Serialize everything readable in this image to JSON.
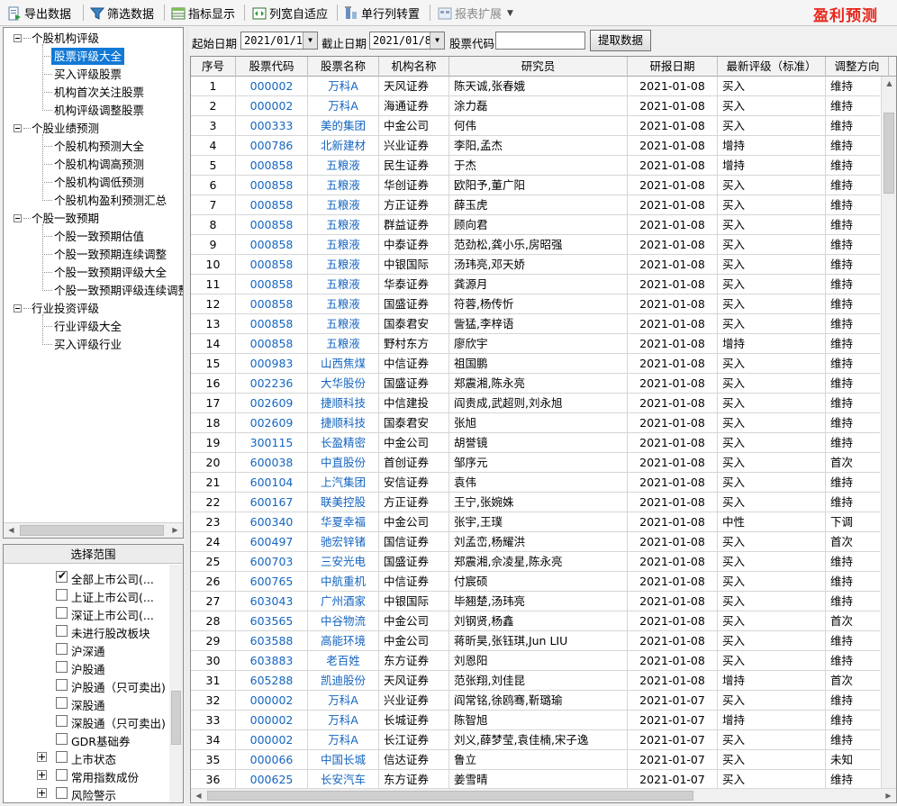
{
  "toolbar": {
    "export_label": "导出数据",
    "filter_label": "筛选数据",
    "indicator_label": "指标显示",
    "autofit_label": "列宽自适应",
    "transpose_label": "单行列转置",
    "extend_label": "报表扩展",
    "brand": "盈利预测"
  },
  "tree": {
    "groups": [
      {
        "label": "个股机构评级",
        "items": [
          "股票评级大全",
          "买入评级股票",
          "机构首次关注股票",
          "机构评级调整股票"
        ]
      },
      {
        "label": "个股业绩预测",
        "items": [
          "个股机构预测大全",
          "个股机构调高预测",
          "个股机构调低预测",
          "个股机构盈利预测汇总"
        ]
      },
      {
        "label": "个股一致预期",
        "items": [
          "个股一致预期估值",
          "个股一致预期连续调整",
          "个股一致预期评级大全",
          "个股一致预期评级连续调整"
        ]
      },
      {
        "label": "行业投资评级",
        "items": [
          "行业评级大全",
          "买入评级行业"
        ]
      }
    ],
    "selected": "股票评级大全"
  },
  "range": {
    "header": "选择范围",
    "items": [
      {
        "label": "全部上市公司(...",
        "checked": true
      },
      {
        "label": "上证上市公司(...",
        "checked": false
      },
      {
        "label": "深证上市公司(...",
        "checked": false
      },
      {
        "label": "未进行股改板块",
        "checked": false
      },
      {
        "label": "沪深通",
        "checked": false
      },
      {
        "label": "沪股通",
        "checked": false
      },
      {
        "label": "沪股通（只可卖出)",
        "checked": false
      },
      {
        "label": "深股通",
        "checked": false
      },
      {
        "label": "深股通（只可卖出)",
        "checked": false
      },
      {
        "label": "GDR基础券",
        "checked": false
      }
    ],
    "expandable": [
      "上市状态",
      "常用指数成份",
      "风险警示"
    ]
  },
  "filter": {
    "start_label": "起始日期",
    "start_value": "2021/01/1",
    "end_label": "截止日期",
    "end_value": "2021/01/8",
    "code_label": "股票代码",
    "code_value": "",
    "fetch_label": "提取数据"
  },
  "grid": {
    "columns": [
      "序号",
      "股票代码",
      "股票名称",
      "机构名称",
      "研究员",
      "研报日期",
      "最新评级（标准）",
      "调整方向"
    ],
    "rows": [
      [
        "1",
        "000002",
        "万科A",
        "天风证券",
        "陈天诚,张春娥",
        "2021-01-08",
        "买入",
        "维持"
      ],
      [
        "2",
        "000002",
        "万科A",
        "海通证券",
        "涂力磊",
        "2021-01-08",
        "买入",
        "维持"
      ],
      [
        "3",
        "000333",
        "美的集团",
        "中金公司",
        "何伟",
        "2021-01-08",
        "买入",
        "维持"
      ],
      [
        "4",
        "000786",
        "北新建材",
        "兴业证券",
        "李阳,孟杰",
        "2021-01-08",
        "增持",
        "维持"
      ],
      [
        "5",
        "000858",
        "五粮液",
        "民生证券",
        "于杰",
        "2021-01-08",
        "增持",
        "维持"
      ],
      [
        "6",
        "000858",
        "五粮液",
        "华创证券",
        "欧阳予,董广阳",
        "2021-01-08",
        "买入",
        "维持"
      ],
      [
        "7",
        "000858",
        "五粮液",
        "方正证券",
        "薛玉虎",
        "2021-01-08",
        "买入",
        "维持"
      ],
      [
        "8",
        "000858",
        "五粮液",
        "群益证券",
        "顾向君",
        "2021-01-08",
        "买入",
        "维持"
      ],
      [
        "9",
        "000858",
        "五粮液",
        "中泰证券",
        "范劲松,龚小乐,房昭强",
        "2021-01-08",
        "买入",
        "维持"
      ],
      [
        "10",
        "000858",
        "五粮液",
        "中银国际",
        "汤玮亮,邓天娇",
        "2021-01-08",
        "买入",
        "维持"
      ],
      [
        "11",
        "000858",
        "五粮液",
        "华泰证券",
        "龚源月",
        "2021-01-08",
        "买入",
        "维持"
      ],
      [
        "12",
        "000858",
        "五粮液",
        "国盛证券",
        "符蓉,杨传忻",
        "2021-01-08",
        "买入",
        "维持"
      ],
      [
        "13",
        "000858",
        "五粮液",
        "国泰君安",
        "訾猛,李梓语",
        "2021-01-08",
        "买入",
        "维持"
      ],
      [
        "14",
        "000858",
        "五粮液",
        "野村东方",
        "廖欣宇",
        "2021-01-08",
        "增持",
        "维持"
      ],
      [
        "15",
        "000983",
        "山西焦煤",
        "中信证券",
        "祖国鹏",
        "2021-01-08",
        "买入",
        "维持"
      ],
      [
        "16",
        "002236",
        "大华股份",
        "国盛证券",
        "郑震湘,陈永亮",
        "2021-01-08",
        "买入",
        "维持"
      ],
      [
        "17",
        "002609",
        "捷顺科技",
        "中信建投",
        "阎贵成,武超则,刘永旭",
        "2021-01-08",
        "买入",
        "维持"
      ],
      [
        "18",
        "002609",
        "捷顺科技",
        "国泰君安",
        "张旭",
        "2021-01-08",
        "买入",
        "维持"
      ],
      [
        "19",
        "300115",
        "长盈精密",
        "中金公司",
        "胡誉镜",
        "2021-01-08",
        "买入",
        "维持"
      ],
      [
        "20",
        "600038",
        "中直股份",
        "首创证券",
        "邹序元",
        "2021-01-08",
        "买入",
        "首次"
      ],
      [
        "21",
        "600104",
        "上汽集团",
        "安信证券",
        "袁伟",
        "2021-01-08",
        "买入",
        "维持"
      ],
      [
        "22",
        "600167",
        "联美控股",
        "方正证券",
        "王宁,张婉姝",
        "2021-01-08",
        "买入",
        "维持"
      ],
      [
        "23",
        "600340",
        "华夏幸福",
        "中金公司",
        "张宇,王璞",
        "2021-01-08",
        "中性",
        "下调"
      ],
      [
        "24",
        "600497",
        "驰宏锌锗",
        "国信证券",
        "刘孟峦,杨耀洪",
        "2021-01-08",
        "买入",
        "首次"
      ],
      [
        "25",
        "600703",
        "三安光电",
        "国盛证券",
        "郑震湘,佘凌星,陈永亮",
        "2021-01-08",
        "买入",
        "维持"
      ],
      [
        "26",
        "600765",
        "中航重机",
        "中信证券",
        "付宸硕",
        "2021-01-08",
        "买入",
        "维持"
      ],
      [
        "27",
        "603043",
        "广州酒家",
        "中银国际",
        "毕翘楚,汤玮亮",
        "2021-01-08",
        "买入",
        "维持"
      ],
      [
        "28",
        "603565",
        "中谷物流",
        "中金公司",
        "刘钢贤,杨鑫",
        "2021-01-08",
        "买入",
        "首次"
      ],
      [
        "29",
        "603588",
        "高能环境",
        "中金公司",
        "蒋昕昊,张钰琪,Jun LIU",
        "2021-01-08",
        "买入",
        "维持"
      ],
      [
        "30",
        "603883",
        "老百姓",
        "东方证券",
        "刘恩阳",
        "2021-01-08",
        "买入",
        "维持"
      ],
      [
        "31",
        "605288",
        "凯迪股份",
        "天风证券",
        "范张翔,刘佳昆",
        "2021-01-08",
        "增持",
        "首次"
      ],
      [
        "32",
        "000002",
        "万科A",
        "兴业证券",
        "阎常铭,徐鸥骞,靳璐瑜",
        "2021-01-07",
        "买入",
        "维持"
      ],
      [
        "33",
        "000002",
        "万科A",
        "长城证券",
        "陈智旭",
        "2021-01-07",
        "增持",
        "维持"
      ],
      [
        "34",
        "000002",
        "万科A",
        "长江证券",
        "刘义,薛梦莹,袁佳楠,宋子逸",
        "2021-01-07",
        "买入",
        "维持"
      ],
      [
        "35",
        "000066",
        "中国长城",
        "信达证券",
        "鲁立",
        "2021-01-07",
        "买入",
        "未知"
      ],
      [
        "36",
        "000625",
        "长安汽车",
        "东方证券",
        "姜雪晴",
        "2021-01-07",
        "买入",
        "维持"
      ]
    ]
  }
}
